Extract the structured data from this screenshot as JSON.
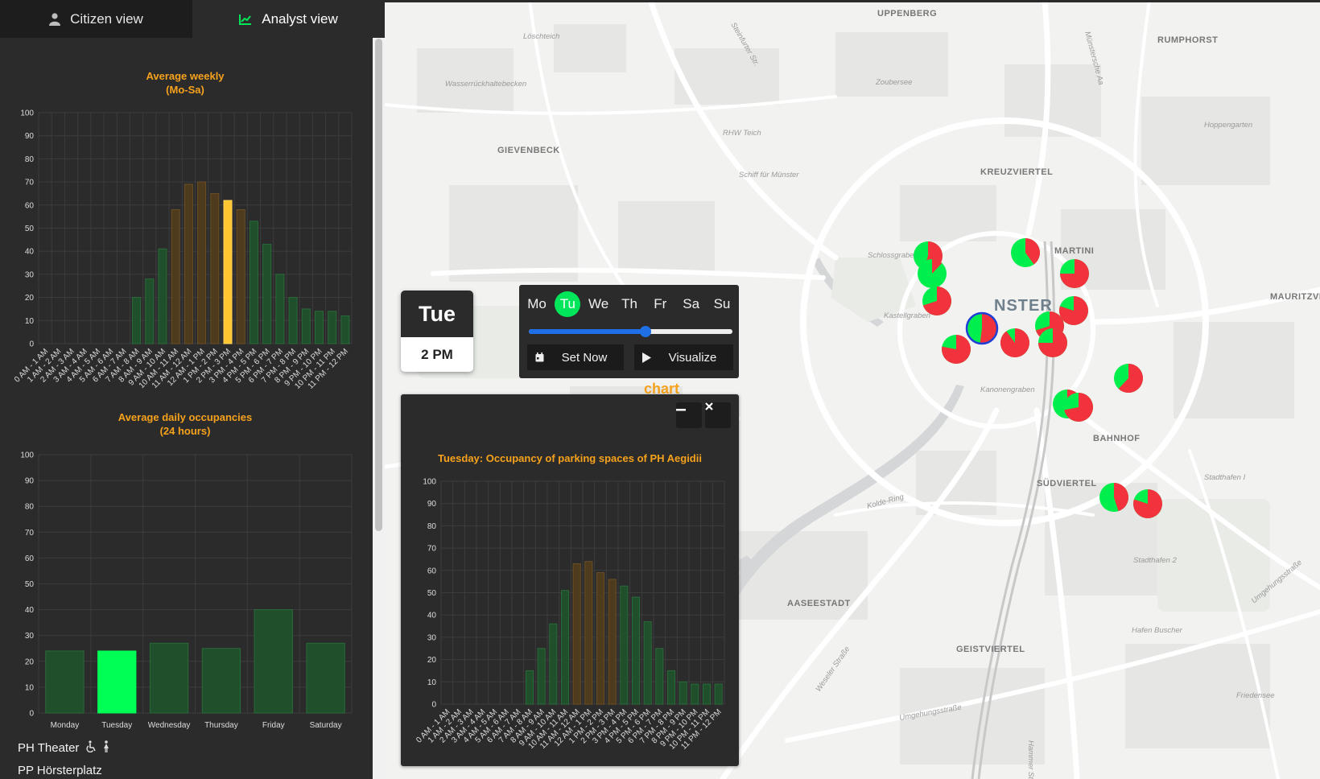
{
  "tabs": {
    "citizen_label": "Citizen view",
    "analyst_label": "Analyst view",
    "citizen_icon": "user-icon",
    "analyst_icon": "chart-line-icon"
  },
  "weekly_chart": {
    "title_line1": "Average weekly",
    "title_line2": "(Mo-Sa)",
    "chart_data": {
      "type": "bar",
      "title": "Average weekly (Mo-Sa)",
      "categories": [
        "0 AM - 1 AM",
        "1 AM - 2 AM",
        "2 AM - 3 AM",
        "3 AM - 4 AM",
        "4 AM - 5 AM",
        "5 AM - 6 AM",
        "6 AM - 7 AM",
        "7 AM - 8 AM",
        "8 AM - 9 AM",
        "9 AM - 10 AM",
        "10 AM - 11 AM",
        "11 AM - 12 AM",
        "12 AM - 1 PM",
        "1 PM - 2 PM",
        "2 PM - 3 PM",
        "3 PM - 4 PM",
        "4 PM - 5 PM",
        "5 PM - 6 PM",
        "6 PM - 7 PM",
        "7 PM - 8 PM",
        "8 PM - 9 PM",
        "9 PM - 10 PM",
        "10 PM - 11 PM",
        "11 PM - 12 PM"
      ],
      "values": [
        0,
        0,
        0,
        0,
        0,
        0,
        0,
        20,
        28,
        41,
        58,
        69,
        70,
        65,
        62,
        58,
        53,
        43,
        30,
        20,
        15,
        14,
        14,
        12
      ],
      "colors": [
        "dark-green",
        "dark-green",
        "dark-green",
        "dark-green",
        "dark-green",
        "dark-green",
        "dark-green",
        "dark-green",
        "dark-green",
        "dark-green",
        "dark-orange",
        "dark-orange",
        "dark-orange",
        "dark-orange",
        "highlight",
        "dark-orange",
        "dark-green",
        "dark-green",
        "dark-green",
        "dark-green",
        "dark-green",
        "dark-green",
        "dark-green",
        "dark-green"
      ],
      "ylim": [
        0,
        100
      ],
      "yticks": [
        0,
        10,
        20,
        30,
        40,
        50,
        60,
        70,
        80,
        90,
        100
      ],
      "grid": true
    }
  },
  "daily_chart": {
    "title_line1": "Average daily occupancies",
    "title_line2": "(24 hours)",
    "chart_data": {
      "type": "bar",
      "title": "Average daily occupancies (24 hours)",
      "categories": [
        "Monday",
        "Tuesday",
        "Wednesday",
        "Thursday",
        "Friday",
        "Saturday"
      ],
      "values": [
        24,
        24,
        27,
        25,
        40,
        27
      ],
      "highlight_index": 1,
      "ylim": [
        0,
        100
      ],
      "yticks": [
        0,
        10,
        20,
        30,
        40,
        50,
        60,
        70,
        80,
        90,
        100
      ],
      "grid": true
    }
  },
  "parking_list": [
    {
      "name": "PH Theater",
      "icons": [
        "wheelchair-icon",
        "woman-icon"
      ]
    },
    {
      "name": "PP Hörsterplatz",
      "icons": []
    }
  ],
  "day_card": {
    "day": "Tue",
    "time": "2 PM"
  },
  "controls": {
    "days": [
      "Mo",
      "Tu",
      "We",
      "Th",
      "Fr",
      "Sa",
      "Su"
    ],
    "active_day": 1,
    "slider_value": 0.575,
    "set_now_label": "Set Now",
    "visualize_label": "Visualize",
    "set_now_icon": "calendar-icon",
    "visualize_icon": "play-icon"
  },
  "floating_label": "chart",
  "popup": {
    "minimize_icon": "minimize-icon",
    "close_icon": "close-icon",
    "chart_data": {
      "type": "bar",
      "title": "Tuesday: Occupancy of parking spaces of PH Aegidii",
      "categories": [
        "0 AM - 1 AM",
        "1 AM - 2 AM",
        "2 AM - 3 AM",
        "3 AM - 4 AM",
        "4 AM - 5 AM",
        "5 AM - 6 AM",
        "6 AM - 7 AM",
        "7 AM - 8 AM",
        "8 AM - 9 AM",
        "9 AM - 10 AM",
        "10 AM - 11 AM",
        "11 AM - 12 AM",
        "12 AM - 1 PM",
        "1 PM - 2 PM",
        "2 PM - 3 PM",
        "3 PM - 4 PM",
        "4 PM - 5 PM",
        "5 PM - 6 PM",
        "6 PM - 7 PM",
        "7 PM - 8 PM",
        "8 PM - 9 PM",
        "9 PM - 10 PM",
        "10 PM - 11 PM",
        "11 PM - 12 PM"
      ],
      "values": [
        0,
        0,
        0,
        0,
        0,
        0,
        0,
        15,
        25,
        36,
        51,
        63,
        64,
        59,
        56,
        53,
        48,
        37,
        25,
        15,
        10,
        9,
        9,
        9
      ],
      "colors": [
        "dark-green",
        "dark-green",
        "dark-green",
        "dark-green",
        "dark-green",
        "dark-green",
        "dark-green",
        "dark-green",
        "dark-green",
        "dark-green",
        "dark-green",
        "dark-orange",
        "dark-orange",
        "dark-orange",
        "dark-orange",
        "dark-green",
        "dark-green",
        "dark-green",
        "dark-green",
        "dark-green",
        "dark-green",
        "dark-green",
        "dark-green",
        "dark-green"
      ],
      "ylim": [
        0,
        100
      ],
      "yticks": [
        0,
        10,
        20,
        30,
        40,
        50,
        60,
        70,
        80,
        90,
        100
      ],
      "grid": true
    }
  },
  "map": {
    "labels": [
      {
        "text": "UPPENBERG",
        "kind": "district"
      },
      {
        "text": "RUMPHORST",
        "kind": "district"
      },
      {
        "text": "Löschteich",
        "kind": "street"
      },
      {
        "text": "Zoubersee",
        "kind": "street"
      },
      {
        "text": "Wasserrückhaltebecken",
        "kind": "street"
      },
      {
        "text": "RHW Teich",
        "kind": "street"
      },
      {
        "text": "Hoppengarten",
        "kind": "street"
      },
      {
        "text": "GIEVENBECK",
        "kind": "district"
      },
      {
        "text": "Schiff für Münster",
        "kind": "street"
      },
      {
        "text": "KREUZVIERTEL",
        "kind": "district"
      },
      {
        "text": "Schlossgraben",
        "kind": "street"
      },
      {
        "text": "MARTINI",
        "kind": "district"
      },
      {
        "text": "NSTER",
        "kind": "big"
      },
      {
        "text": "MAURITZVIERTEL",
        "kind": "district"
      },
      {
        "text": "Kastellgraben",
        "kind": "street"
      },
      {
        "text": "Kanonengraben",
        "kind": "street"
      },
      {
        "text": "BAHNHOF",
        "kind": "district"
      },
      {
        "text": "SÜDVIERTEL",
        "kind": "district"
      },
      {
        "text": "Stadthafen I",
        "kind": "street"
      },
      {
        "text": "Kolde-Ring",
        "kind": "street"
      },
      {
        "text": "Stadthafen 2",
        "kind": "street"
      },
      {
        "text": "AASEESTADT",
        "kind": "district"
      },
      {
        "text": "GEISTVIERTEL",
        "kind": "district"
      },
      {
        "text": "Hafen Buscher",
        "kind": "street"
      },
      {
        "text": "Friedensee",
        "kind": "street"
      },
      {
        "text": "Umgehungsstraße",
        "kind": "street"
      },
      {
        "text": "Steinfurter Str.",
        "kind": "street"
      },
      {
        "text": "Münstersche Aa",
        "kind": "street"
      },
      {
        "text": "Weseler Straße",
        "kind": "street"
      },
      {
        "text": "Hammer Straße",
        "kind": "street"
      },
      {
        "text": "Umgehungsstraße",
        "kind": "street"
      }
    ],
    "markers": [
      {
        "occupied": 0.55,
        "selected": false
      },
      {
        "occupied": 0.12,
        "selected": false
      },
      {
        "occupied": 0.7,
        "selected": false
      },
      {
        "occupied": 0.4,
        "selected": false
      },
      {
        "occupied": 0.75,
        "selected": false
      },
      {
        "occupied": 0.8,
        "selected": false
      },
      {
        "occupied": 0.7,
        "selected": false
      },
      {
        "occupied": 0.52,
        "selected": true
      },
      {
        "occupied": 0.9,
        "selected": false
      },
      {
        "occupied": 0.75,
        "selected": false
      },
      {
        "occupied": 0.78,
        "selected": false
      },
      {
        "occupied": 0.62,
        "selected": false
      },
      {
        "occupied": 0.45,
        "selected": false
      },
      {
        "occupied": 0.72,
        "selected": false
      },
      {
        "occupied": 0.45,
        "selected": false
      },
      {
        "occupied": 0.8,
        "selected": false
      }
    ]
  }
}
